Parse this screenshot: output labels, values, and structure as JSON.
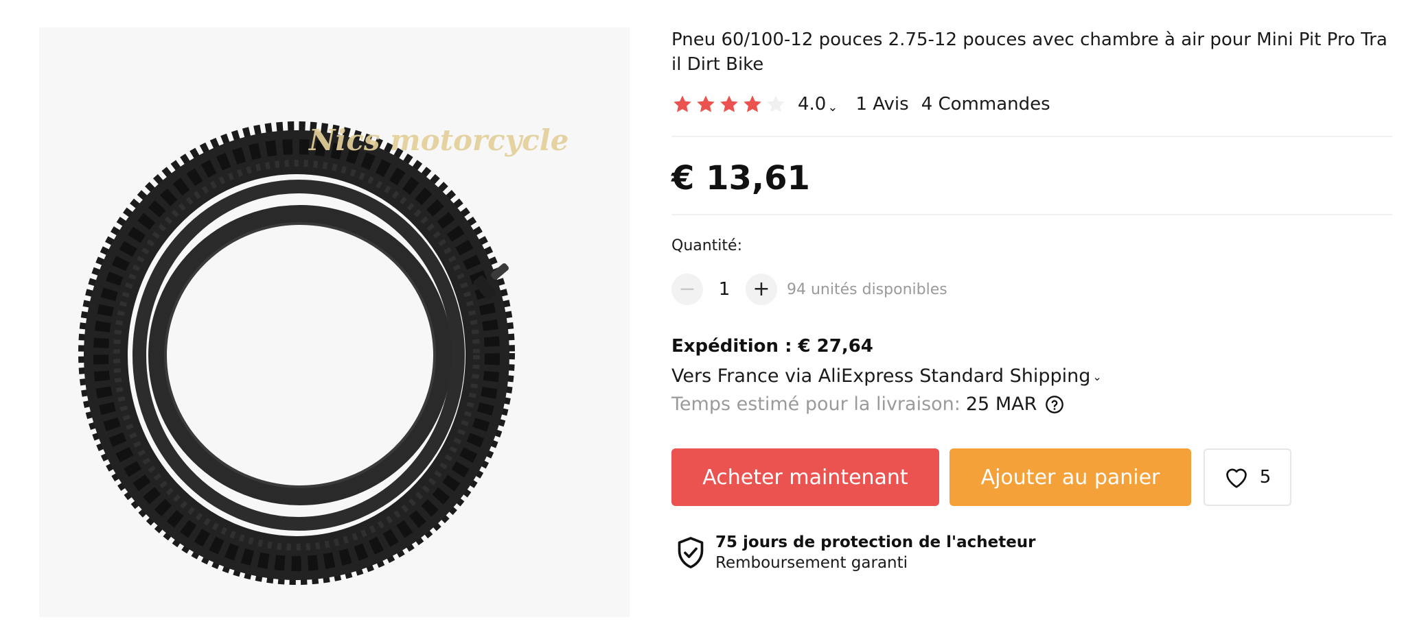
{
  "product": {
    "title": "Pneu 60/100-12 pouces 2.75-12 pouces avec chambre à air pour Mini Pit Pro Trail Dirt Bike",
    "image_watermark": "Nics motorcycle",
    "image_subject": "dirt bike tire with inner tube"
  },
  "rating": {
    "value": "4.0",
    "stars_filled": 4,
    "stars_total": 5,
    "reviews": "1 Avis",
    "orders": "4 Commandes",
    "star_color": "#ea5350"
  },
  "price": "€ 13,61",
  "quantity": {
    "label": "Quantité:",
    "value": "1",
    "minus_icon": "minus-icon",
    "plus_icon": "plus-icon",
    "stock": "94 unités disponibles"
  },
  "shipping": {
    "cost": "Expédition : € 27,64",
    "via": "Vers France via AliExpress Standard Shipping",
    "delivery_label": "Temps estimé pour la livraison:",
    "delivery_date": "25 MAR"
  },
  "actions": {
    "buy_now": "Acheter maintenant",
    "add_to_cart": "Ajouter au panier",
    "wishlist_count": "5",
    "buy_color": "#ea5350",
    "cart_color": "#f3a138"
  },
  "protection": {
    "title": "75 jours de protection de l'acheteur",
    "subtitle": "Remboursement garanti"
  }
}
